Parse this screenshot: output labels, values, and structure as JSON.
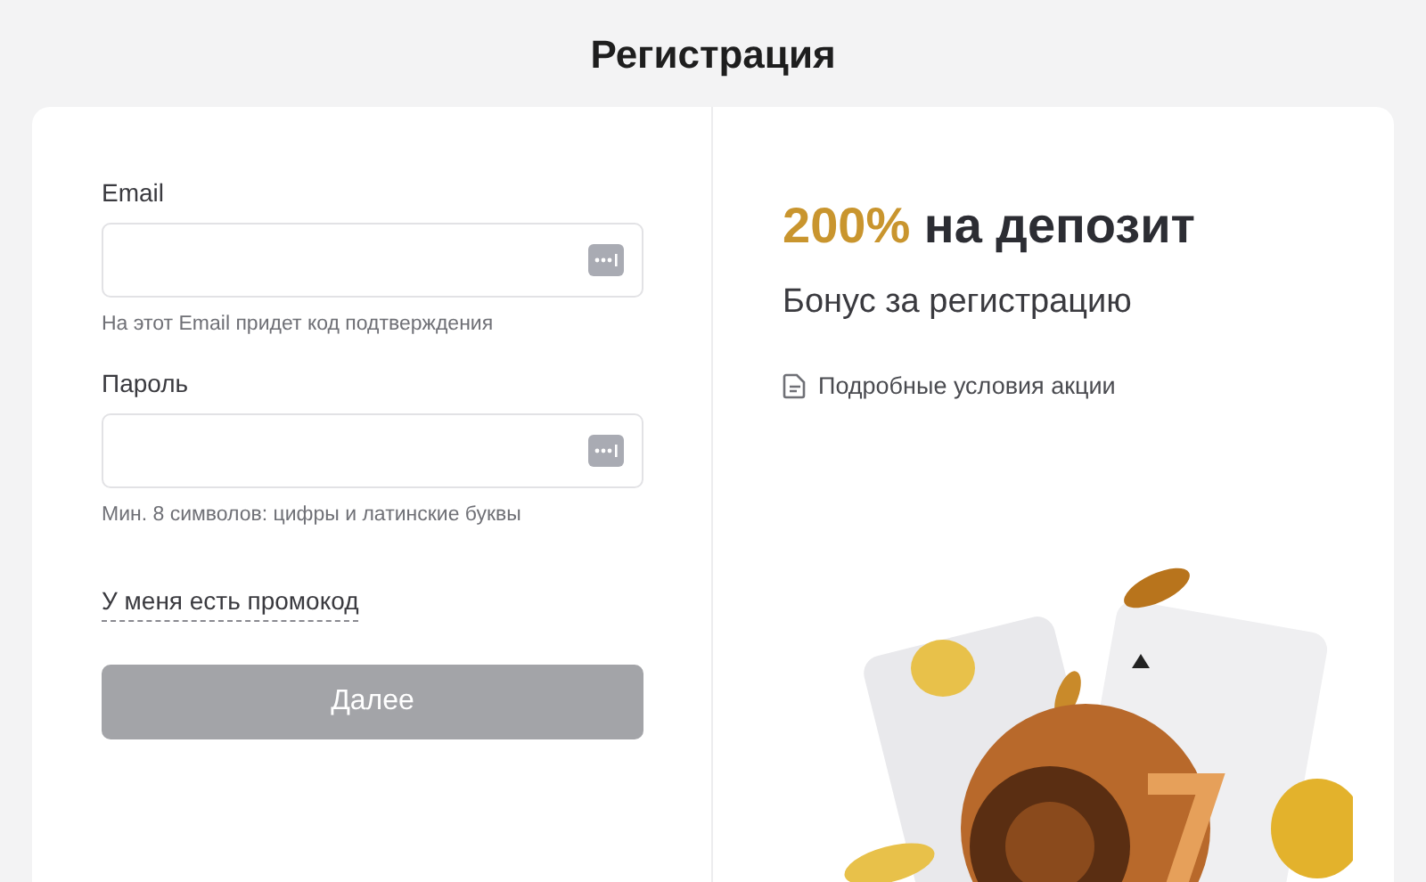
{
  "page_title": "Регистрация",
  "form": {
    "fields": [
      {
        "label": "Email",
        "hint": "На этот Email придет код подтверждения"
      },
      {
        "label": "Пароль",
        "hint": "Мин. 8 символов: цифры и латинские буквы"
      }
    ],
    "promo_link": "У меня есть промокод",
    "submit": {
      "label": "Далее",
      "disabled": true
    }
  },
  "promo": {
    "highlight": "200%",
    "headline": "на депозит",
    "subtitle": "Бонус за регистрацию",
    "terms_link": "Подробные условия акции"
  }
}
